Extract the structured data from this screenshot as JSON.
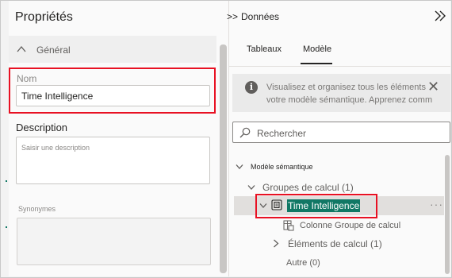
{
  "properties": {
    "title": "Propriétés",
    "section": "Général",
    "name_label": "Nom",
    "name_value": "Time Intelligence",
    "description_label": "Description",
    "description_placeholder": "Saisir une description",
    "synonyms_label": "Synonymes"
  },
  "data_pane": {
    "expand_label": ">>",
    "title": "Données",
    "tabs": [
      {
        "label": "Tableaux",
        "active": false
      },
      {
        "label": "Modèle",
        "active": true
      }
    ],
    "banner_line1": "Visualisez et organisez tous les éléments",
    "banner_line2": "votre modèle sémantique. Apprenez comm",
    "search_placeholder": "Rechercher",
    "tree": {
      "root": "Modèle sémantique",
      "calc_groups": "Groupes de calcul (1)",
      "selected_item": "Time Intelligence",
      "calc_group_column": "Colonne Groupe de calcul",
      "calc_items": "Éléments de calcul (1)",
      "other": "Autre (0)",
      "more_label": "···"
    }
  },
  "colors": {
    "accent": "#117865",
    "highlight_border": "#e81123"
  }
}
